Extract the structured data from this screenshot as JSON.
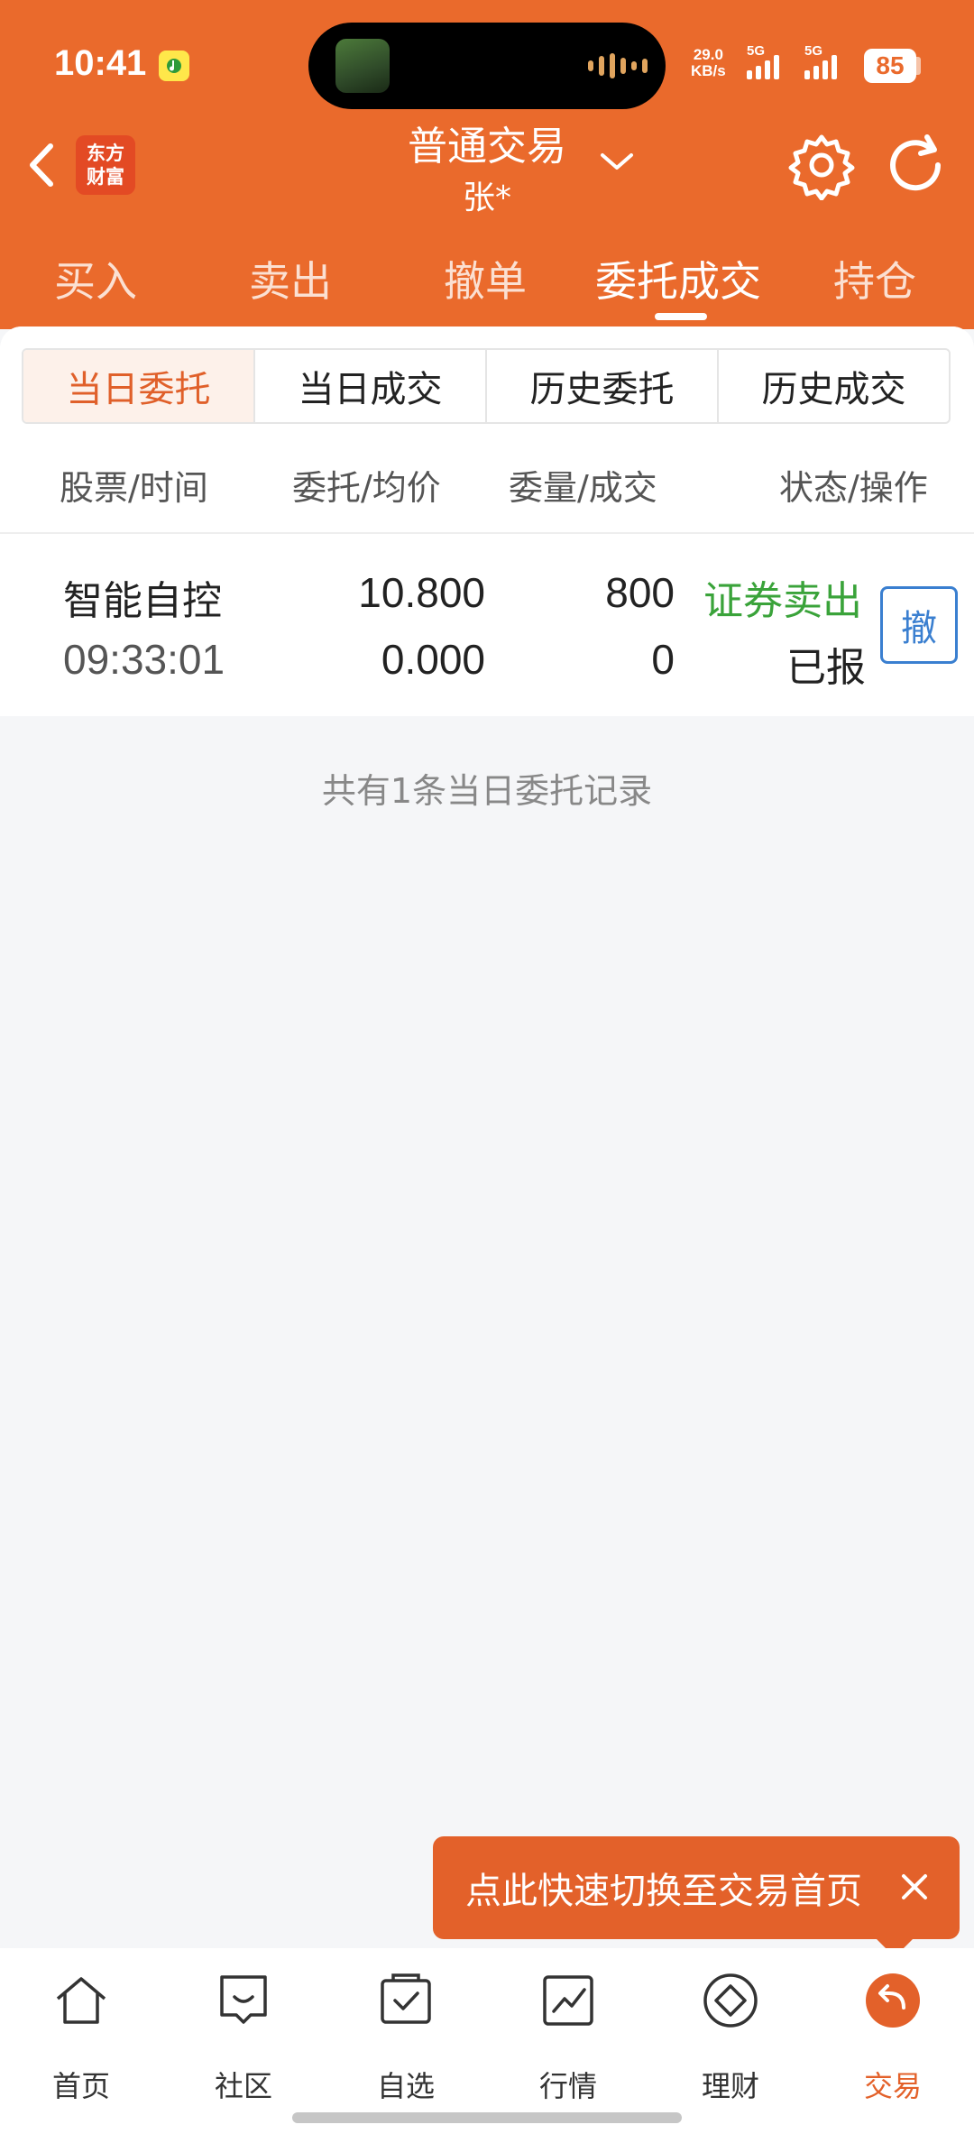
{
  "status_bar": {
    "time": "10:41",
    "net_speed": "29.0",
    "net_unit": "KB/s",
    "sig1_label": "5G",
    "sig2_label": "5G",
    "battery": "85"
  },
  "header": {
    "logo_line1": "东方",
    "logo_line2": "财富",
    "title": "普通交易",
    "subtitle": "张*",
    "back_icon": "chevron-left-icon",
    "settings_icon": "gear-icon",
    "refresh_icon": "refresh-icon"
  },
  "tabs": [
    {
      "label": "买入"
    },
    {
      "label": "卖出"
    },
    {
      "label": "撤单"
    },
    {
      "label": "委托成交",
      "active": true
    },
    {
      "label": "持仓"
    }
  ],
  "segments": [
    {
      "label": "当日委托",
      "active": true
    },
    {
      "label": "当日成交"
    },
    {
      "label": "历史委托"
    },
    {
      "label": "历史成交"
    }
  ],
  "columns": [
    "股票/时间",
    "委托/均价",
    "委量/成交",
    "状态/操作"
  ],
  "orders": [
    {
      "stock": "智能自控",
      "time": "09:33:01",
      "order_price": "10.800",
      "avg_price": "0.000",
      "order_qty": "800",
      "filled_qty": "0",
      "direction": "证券卖出",
      "status": "已报",
      "cancel_label": "撤"
    }
  ],
  "summary": "共有1条当日委托记录",
  "toast": {
    "text": "点此快速切换至交易首页"
  },
  "bottom_nav": [
    {
      "label": "首页",
      "icon": "home-icon"
    },
    {
      "label": "社区",
      "icon": "community-icon"
    },
    {
      "label": "自选",
      "icon": "watchlist-icon"
    },
    {
      "label": "行情",
      "icon": "market-icon"
    },
    {
      "label": "理财",
      "icon": "wealth-icon"
    },
    {
      "label": "交易",
      "icon": "trade-icon",
      "active": true
    }
  ],
  "colors": {
    "brand": "#ea6a2c",
    "sell_green": "#3aa33a",
    "cancel_blue": "#3a7fd0"
  }
}
